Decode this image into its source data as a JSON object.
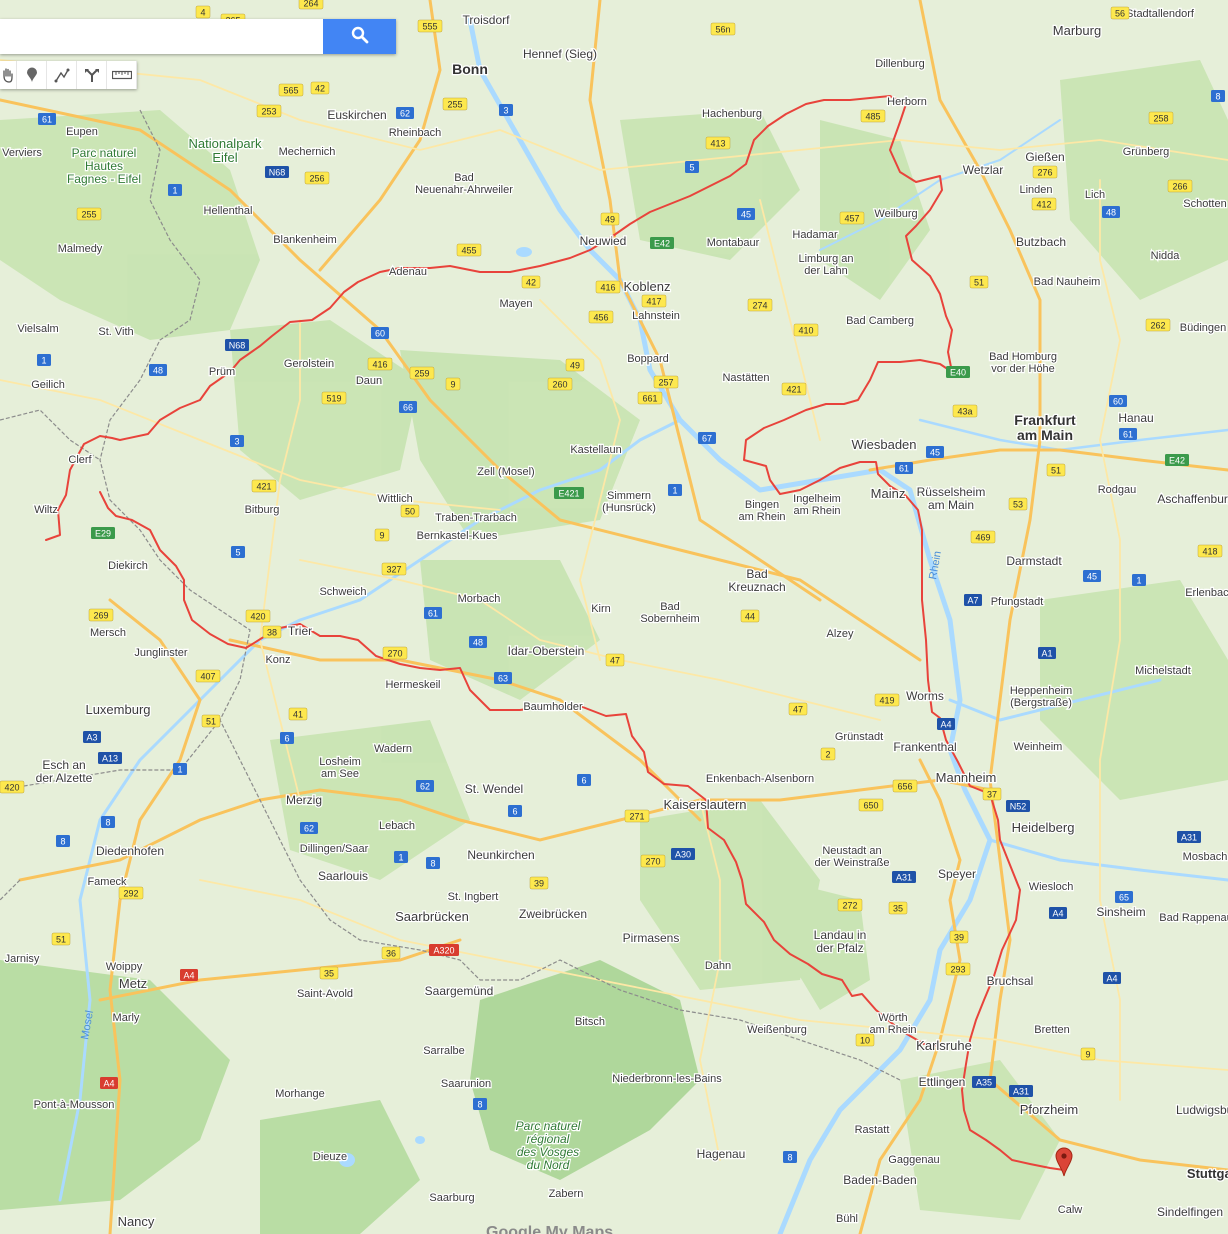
{
  "search": {
    "placeholder": "",
    "value": "",
    "button_icon": "search-icon"
  },
  "toolbar": {
    "tools": [
      {
        "name": "hand-icon"
      },
      {
        "name": "marker-icon"
      },
      {
        "name": "draw-line-icon"
      },
      {
        "name": "directions-icon"
      },
      {
        "name": "ruler-icon"
      }
    ]
  },
  "colors": {
    "route": "#e8433b",
    "water": "#aadaff",
    "forest": "#bfe2a8",
    "road_yellow": "#ffe36e",
    "motorway": "#f9b94b",
    "border": "#8c8c8c",
    "search_button": "#4285f4"
  },
  "map": {
    "cities": [
      "Troisdorf",
      "Bonn",
      "Hennef (Sieg)",
      "Marburg",
      "Stadtallendorf",
      "Dillenburg",
      "Herborn",
      "Euskirchen",
      "Rheinbach",
      "Mechernich",
      "Nationalpark Eifel",
      "Parc naturel Hautes Fagnes - Eifel",
      "Eupen",
      "Verviers",
      "Hellenthal",
      "Malmedy",
      "Blankenheim",
      "Bad Neuenahr-Ahrweiler",
      "Hachenburg",
      "Gießen",
      "Grünberg",
      "Wetzlar",
      "Linden",
      "Lich",
      "Schotten",
      "Weilburg",
      "Hadamar",
      "Montabaur",
      "Neuwied",
      "Koblenz",
      "Lahnstein",
      "Limburg an der Lahn",
      "Butzbach",
      "Nidda",
      "Bad Nauheim",
      "Adenau",
      "Mayen",
      "Vielsalm",
      "St. Vith",
      "Gerolstein",
      "Bad Camberg",
      "Büdingen",
      "Bad Homburg vor der Höhe",
      "Geilich",
      "Prüm",
      "Daun",
      "Boppard",
      "Nastätten",
      "Frankfurt am Main",
      "Hanau",
      "Wiesbaden",
      "Kastellaun",
      "Zell (Mosel)",
      "Clerf",
      "Wiltz",
      "Mainz",
      "Rüsselsheim am Main",
      "Rodgau",
      "Aschaffenburg",
      "Wittlich",
      "Traben-Trarbach",
      "Simmern (Hunsrück)",
      "Bitburg",
      "Bernkastel-Kues",
      "Ingelheim am Rhein",
      "Bingen am Rhein",
      "Diekirch",
      "Darmstadt",
      "Bad Kreuznach",
      "Schweich",
      "Morbach",
      "Pfungstadt",
      "Kirn",
      "Bad Sobernheim",
      "Erlenbach",
      "Mersch",
      "Trier",
      "Junglinster",
      "Konz",
      "Idar-Oberstein",
      "Alzey",
      "Michelstadt",
      "Worms",
      "Heppenheim (Bergstraße)",
      "Hermeskeil",
      "Baumholder",
      "Luxemburg",
      "Grünstadt",
      "Frankenthal",
      "Weinheim",
      "Esch an der Alzette",
      "Wadern",
      "Losheim am See",
      "Enkenbach-Alsenborn",
      "Mannheim",
      "St. Wendel",
      "Merzig",
      "Kaiserslautern",
      "Heidelberg",
      "Lebach",
      "Mosbach",
      "Diedenhofen",
      "Dillingen/Saar",
      "Neustadt an der Weinstraße",
      "Neunkirchen",
      "Saarlouis",
      "Speyer",
      "Wiesloch",
      "Fameck",
      "St. Ingbert",
      "Sinsheim",
      "Saarbrücken",
      "Zweibrücken",
      "Bad Rappenau",
      "Landau in der Pfalz",
      "Pirmasens",
      "Jarnisy",
      "Woippy",
      "Dahn",
      "Bruchsal",
      "Metz",
      "Saint-Avold",
      "Saargemünd",
      "Marly",
      "Bitsch",
      "Weißenburg",
      "Wörth am Rhein",
      "Bretten",
      "Sarralbe",
      "Karlsruhe",
      "Niederbronn-les-Bains",
      "Saarunion",
      "Ettlingen",
      "Pont-à-Mousson",
      "Morhange",
      "Pforzheim",
      "Parc naturel régional des Vosges du Nord",
      "Rastatt",
      "Ludwigsburg",
      "Dieuze",
      "Hagenau",
      "Gaggenau",
      "Baden-Baden",
      "Stuttgart",
      "Saarburg",
      "Zabern",
      "Sindelfingen",
      "Calw",
      "Nancy",
      "Bühl"
    ],
    "rivers": [
      "Rhein",
      "Mosel"
    ],
    "roads": [
      "4",
      "264",
      "555",
      "E40",
      "56",
      "56n",
      "265",
      "61",
      "565",
      "42",
      "253",
      "62",
      "255",
      "3",
      "8",
      "413",
      "485",
      "5",
      "276",
      "258",
      "266",
      "1",
      "N68",
      "256",
      "255",
      "49",
      "45",
      "457",
      "412",
      "48",
      "455",
      "E42",
      "61",
      "262",
      "42",
      "416",
      "417",
      "456",
      "274",
      "51",
      "410",
      "N68",
      "60",
      "1",
      "48",
      "416",
      "259",
      "49",
      "9",
      "260",
      "257",
      "421",
      "519",
      "66",
      "43a",
      "60",
      "61",
      "3",
      "661",
      "45",
      "51",
      "E42",
      "421",
      "50",
      "E421",
      "1",
      "E29",
      "9",
      "5",
      "67",
      "53",
      "469",
      "327",
      "418",
      "61",
      "420",
      "38",
      "44",
      "45",
      "A7",
      "1",
      "269",
      "270",
      "48",
      "47",
      "A1",
      "407",
      "41",
      "63",
      "47",
      "419",
      "51",
      "6",
      "2",
      "A4",
      "A3",
      "A13",
      "1",
      "62",
      "6",
      "271",
      "650",
      "656",
      "N52",
      "420",
      "6",
      "37",
      "A31",
      "8",
      "62",
      "270",
      "A30",
      "8",
      "1",
      "8",
      "39",
      "A31",
      "292",
      "65",
      "272",
      "35",
      "39",
      "A4",
      "51",
      "A320",
      "36",
      "293",
      "A4",
      "A4",
      "35",
      "9",
      "10",
      "A31",
      "A4",
      "8",
      "A35",
      "8"
    ],
    "watermark": "Google My Maps"
  }
}
